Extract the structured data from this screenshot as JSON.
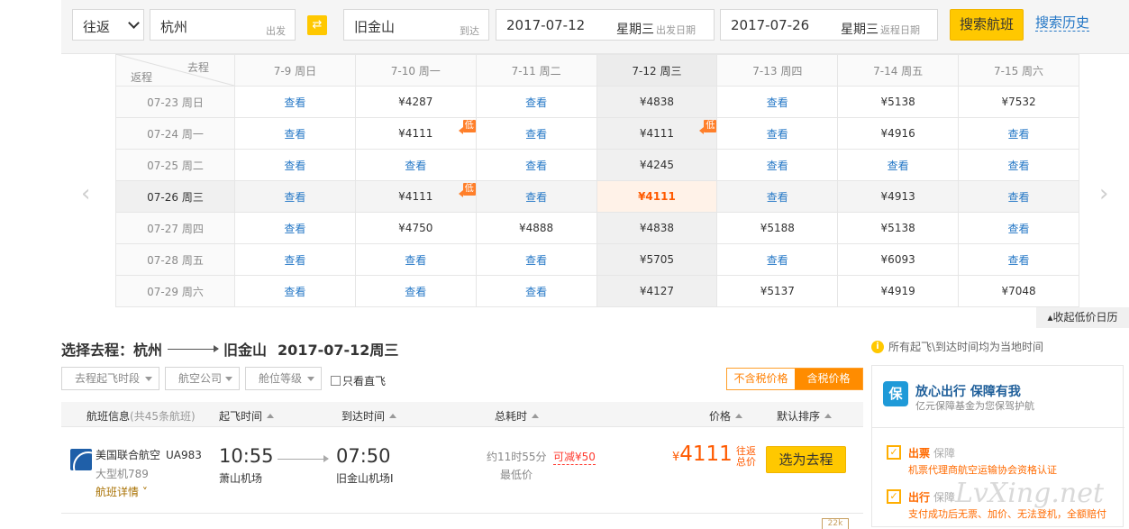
{
  "search": {
    "trip_type": "往返",
    "from_value": "杭州",
    "from_hint": "出发",
    "to_value": "旧金山",
    "to_hint": "到达",
    "depart_date": "2017-07-12",
    "depart_weekday": "星期三",
    "depart_hint": "出发日期",
    "return_date": "2017-07-26",
    "return_weekday": "星期三",
    "return_hint": "返程日期",
    "search_button": "搜索航班",
    "history_link": "搜索历史"
  },
  "calendar": {
    "corner_outbound": "去程",
    "corner_return": "返程",
    "columns": [
      "7-9 周日",
      "7-10 周一",
      "7-11 周二",
      "7-12 周三",
      "7-13 周四",
      "7-14 周五",
      "7-15 周六"
    ],
    "rows": [
      {
        "label": "07-23 周日",
        "cells": [
          "查看",
          "¥4287",
          "查看",
          "¥4838",
          "查看",
          "¥5138",
          "¥7532"
        ]
      },
      {
        "label": "07-24 周一",
        "cells": [
          "查看",
          "¥4111",
          "查看",
          "¥4111",
          "查看",
          "¥4916",
          "查看"
        ]
      },
      {
        "label": "07-25 周二",
        "cells": [
          "查看",
          "查看",
          "查看",
          "¥4245",
          "查看",
          "查看",
          "查看"
        ]
      },
      {
        "label": "07-26 周三",
        "cells": [
          "查看",
          "¥4111",
          "查看",
          "¥4111",
          "查看",
          "¥4913",
          "查看"
        ]
      },
      {
        "label": "07-27 周四",
        "cells": [
          "查看",
          "¥4750",
          "¥4888",
          "¥4838",
          "¥5188",
          "¥5138",
          "查看"
        ]
      },
      {
        "label": "07-28 周五",
        "cells": [
          "查看",
          "查看",
          "查看",
          "¥5705",
          "查看",
          "¥6093",
          "查看"
        ]
      },
      {
        "label": "07-29 周六",
        "cells": [
          "查看",
          "查看",
          "查看",
          "¥4127",
          "¥5137",
          "¥4919",
          "¥7048"
        ]
      }
    ],
    "low_badge": "低",
    "collapse_label": "收起低价日历"
  },
  "route": {
    "prefix": "选择去程：",
    "from": "杭州",
    "to": "旧金山",
    "date": "2017-07-12周三"
  },
  "filters": {
    "dep_time": "去程起飞时段",
    "airline": "航空公司",
    "cabin": "舱位等级",
    "direct_only": "只看直飞",
    "tax_off": "不含税价格",
    "tax_on": "含税价格"
  },
  "list_header": {
    "flight_info": "航班信息",
    "count": "(共45条航班)",
    "dep_time": "起飞时间",
    "arr_time": "到达时间",
    "duration": "总耗时",
    "price": "价格",
    "sort": "默认排序"
  },
  "flight": {
    "airline": "美国联合航空",
    "number": "UA983",
    "plane": "大型机789",
    "details": "航班详情",
    "dep_time": "10:55",
    "dep_airport": "萧山机场",
    "arr_time": "07:50",
    "arr_airport": "旧金山机场I",
    "duration": "约11时55分",
    "lowest": "最低价",
    "reduce": "可减¥50",
    "currency": "¥",
    "price": "4111",
    "price_tag_1": "往返",
    "price_tag_2": "总价",
    "choose_button": "选为去程"
  },
  "side": {
    "timezone_note": "所有起飞\\到达时间均为当地时间",
    "guarantee_title": "放心出行 保障有我",
    "guarantee_sub": "亿元保障基金为您保驾护航",
    "item1_title": "出票",
    "item1_tag": "保障",
    "item1_desc": "机票代理商航空运输协会资格认证",
    "item2_title": "出行",
    "item2_tag": "保障",
    "item2_desc": "支付成功后无票、加价、无法登机，全额赔付"
  },
  "watermark": "LvXing.net",
  "badge_small": "22k"
}
